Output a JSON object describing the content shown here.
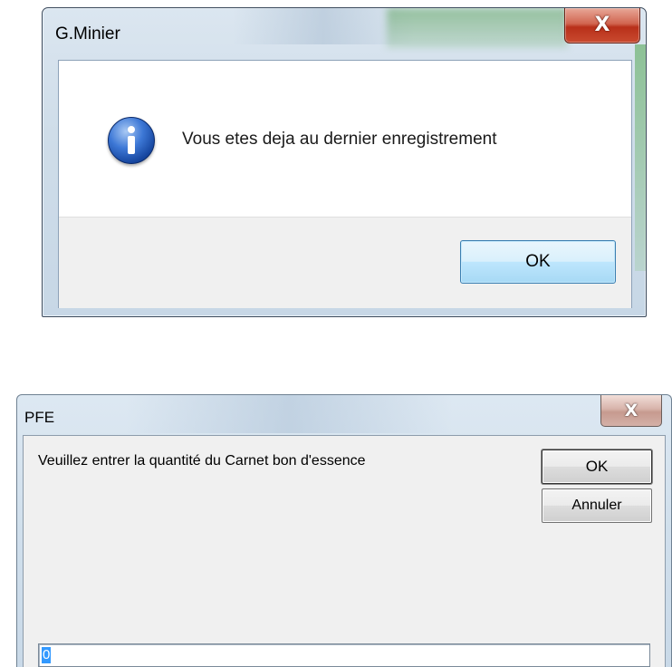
{
  "dialog1": {
    "title": "G.Minier",
    "close_glyph": "X",
    "icon": "info-icon",
    "message": "Vous etes deja au dernier enregistrement",
    "ok_label": "OK"
  },
  "dialog2": {
    "title": "PFE",
    "close_glyph": "X",
    "prompt": "Veuillez entrer la quantité du Carnet bon d'essence",
    "ok_label": "OK",
    "cancel_label": "Annuler",
    "input_value": "0"
  },
  "colors": {
    "close_button_active": "#c94a2f",
    "close_button_inactive": "#d4b0a7",
    "focused_button": "#bee6fd",
    "selection": "#3399ff"
  }
}
